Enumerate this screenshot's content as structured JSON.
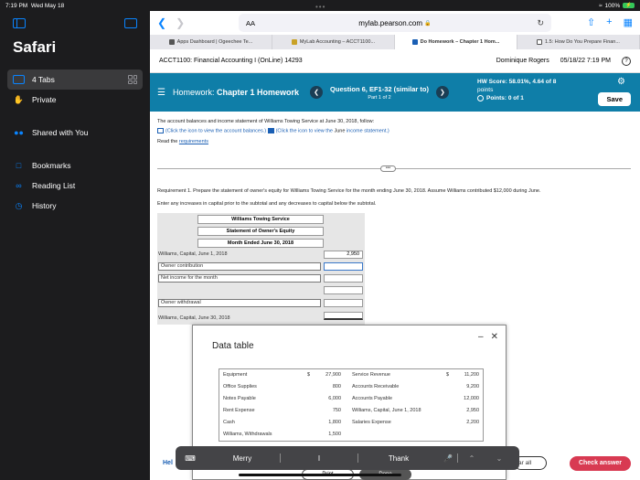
{
  "status": {
    "time": "7:19 PM",
    "date": "Wed May 18",
    "battery": "100%"
  },
  "sidebar": {
    "title": "Safari",
    "tabs_label": "4 Tabs",
    "items": [
      {
        "label": "Private",
        "icon": "hand-icon"
      },
      {
        "label": "Shared with You",
        "icon": "people-icon"
      },
      {
        "label": "Bookmarks",
        "icon": "bookmark-icon"
      },
      {
        "label": "Reading List",
        "icon": "glasses-icon"
      },
      {
        "label": "History",
        "icon": "clock-icon"
      }
    ]
  },
  "browser": {
    "url": "mylab.pearson.com",
    "aa": "AA",
    "tabs": [
      {
        "label": "Apps Dashboard | Ogeechee Te..."
      },
      {
        "label": "MyLab Accounting – ACCT1100..."
      },
      {
        "label": "Do Homework – Chapter 1 Hom..."
      },
      {
        "label": "1.5: How Do You Prepare Finan..."
      }
    ]
  },
  "course": {
    "title": "ACCT1100: Financial Accounting I (OnLine) 14293",
    "user": "Dominique Rogers",
    "datetime": "05/18/22 7:19 PM",
    "help": "?"
  },
  "hw": {
    "label": "Homework:",
    "chapter": "Chapter 1 Homework",
    "question": "Question 6, EF1-32 (similar to)",
    "part": "Part 1 of 2",
    "score_line1": "HW Score: 58.01%, 4.64 of 8",
    "score_line2": "points",
    "points": "Points: 0 of 1",
    "save": "Save"
  },
  "content": {
    "intro": "The account balances and income statement of Williams Towing Service at June 30, 2018, follow:",
    "link1": "(Click the icon to view the account balances.)",
    "link2_pre": "(Click the icon to view the ",
    "link2_june": "June",
    "link2_post": " income statement.)",
    "read": "Read the ",
    "requirements": "requirements",
    "req1": "Requirement 1. Prepare the statement of owner's equity for Williams Towing Service for the month ending June 30, 2018. Assume Williams contributed $12,000 during June.",
    "req_note": "Enter any increases in capital prior to the subtotal and any decreases to capital below the subtotal."
  },
  "worksheet": {
    "company": "Williams Towing Service",
    "statement": "Statement of Owner's Equity",
    "period": "Month Ended June 30, 2018",
    "rows": [
      {
        "label": "Williams, Capital, June 1, 2018",
        "value": "2,950"
      },
      {
        "label": "Owner contribution",
        "value": ""
      },
      {
        "label": "Net income for the month",
        "value": ""
      },
      {
        "label": "",
        "value": ""
      },
      {
        "label": "Owner withdrawal",
        "value": ""
      },
      {
        "label": "Williams, Capital, June 30, 2018",
        "value": ""
      }
    ]
  },
  "datatable": {
    "title": "Data table",
    "rows": [
      {
        "l": "Equipment",
        "d1": "$",
        "v1": "27,900",
        "r": "Service Revenue",
        "d2": "$",
        "v2": "11,200"
      },
      {
        "l": "Office Supplies",
        "d1": "",
        "v1": "800",
        "r": "Accounts Receivable",
        "d2": "",
        "v2": "9,200"
      },
      {
        "l": "Notes Payable",
        "d1": "",
        "v1": "6,000",
        "r": "Accounts Payable",
        "d2": "",
        "v2": "12,000"
      },
      {
        "l": "Rent Expense",
        "d1": "",
        "v1": "750",
        "r": "Williams, Capital, June 1, 2018",
        "d2": "",
        "v2": "2,950"
      },
      {
        "l": "Cash",
        "d1": "",
        "v1": "1,800",
        "r": "Salaries Expense",
        "d2": "",
        "v2": "2,200"
      },
      {
        "l": "Williams, Withdrawals",
        "d1": "",
        "v1": "1,500",
        "r": "",
        "d2": "",
        "v2": ""
      }
    ]
  },
  "keyboard": {
    "s1": "Merry",
    "s2": "I",
    "s3": "Thank"
  },
  "footer": {
    "help": "Hel",
    "clear": "ar all",
    "check": "Check answer",
    "print": "Print",
    "done": "Done"
  }
}
